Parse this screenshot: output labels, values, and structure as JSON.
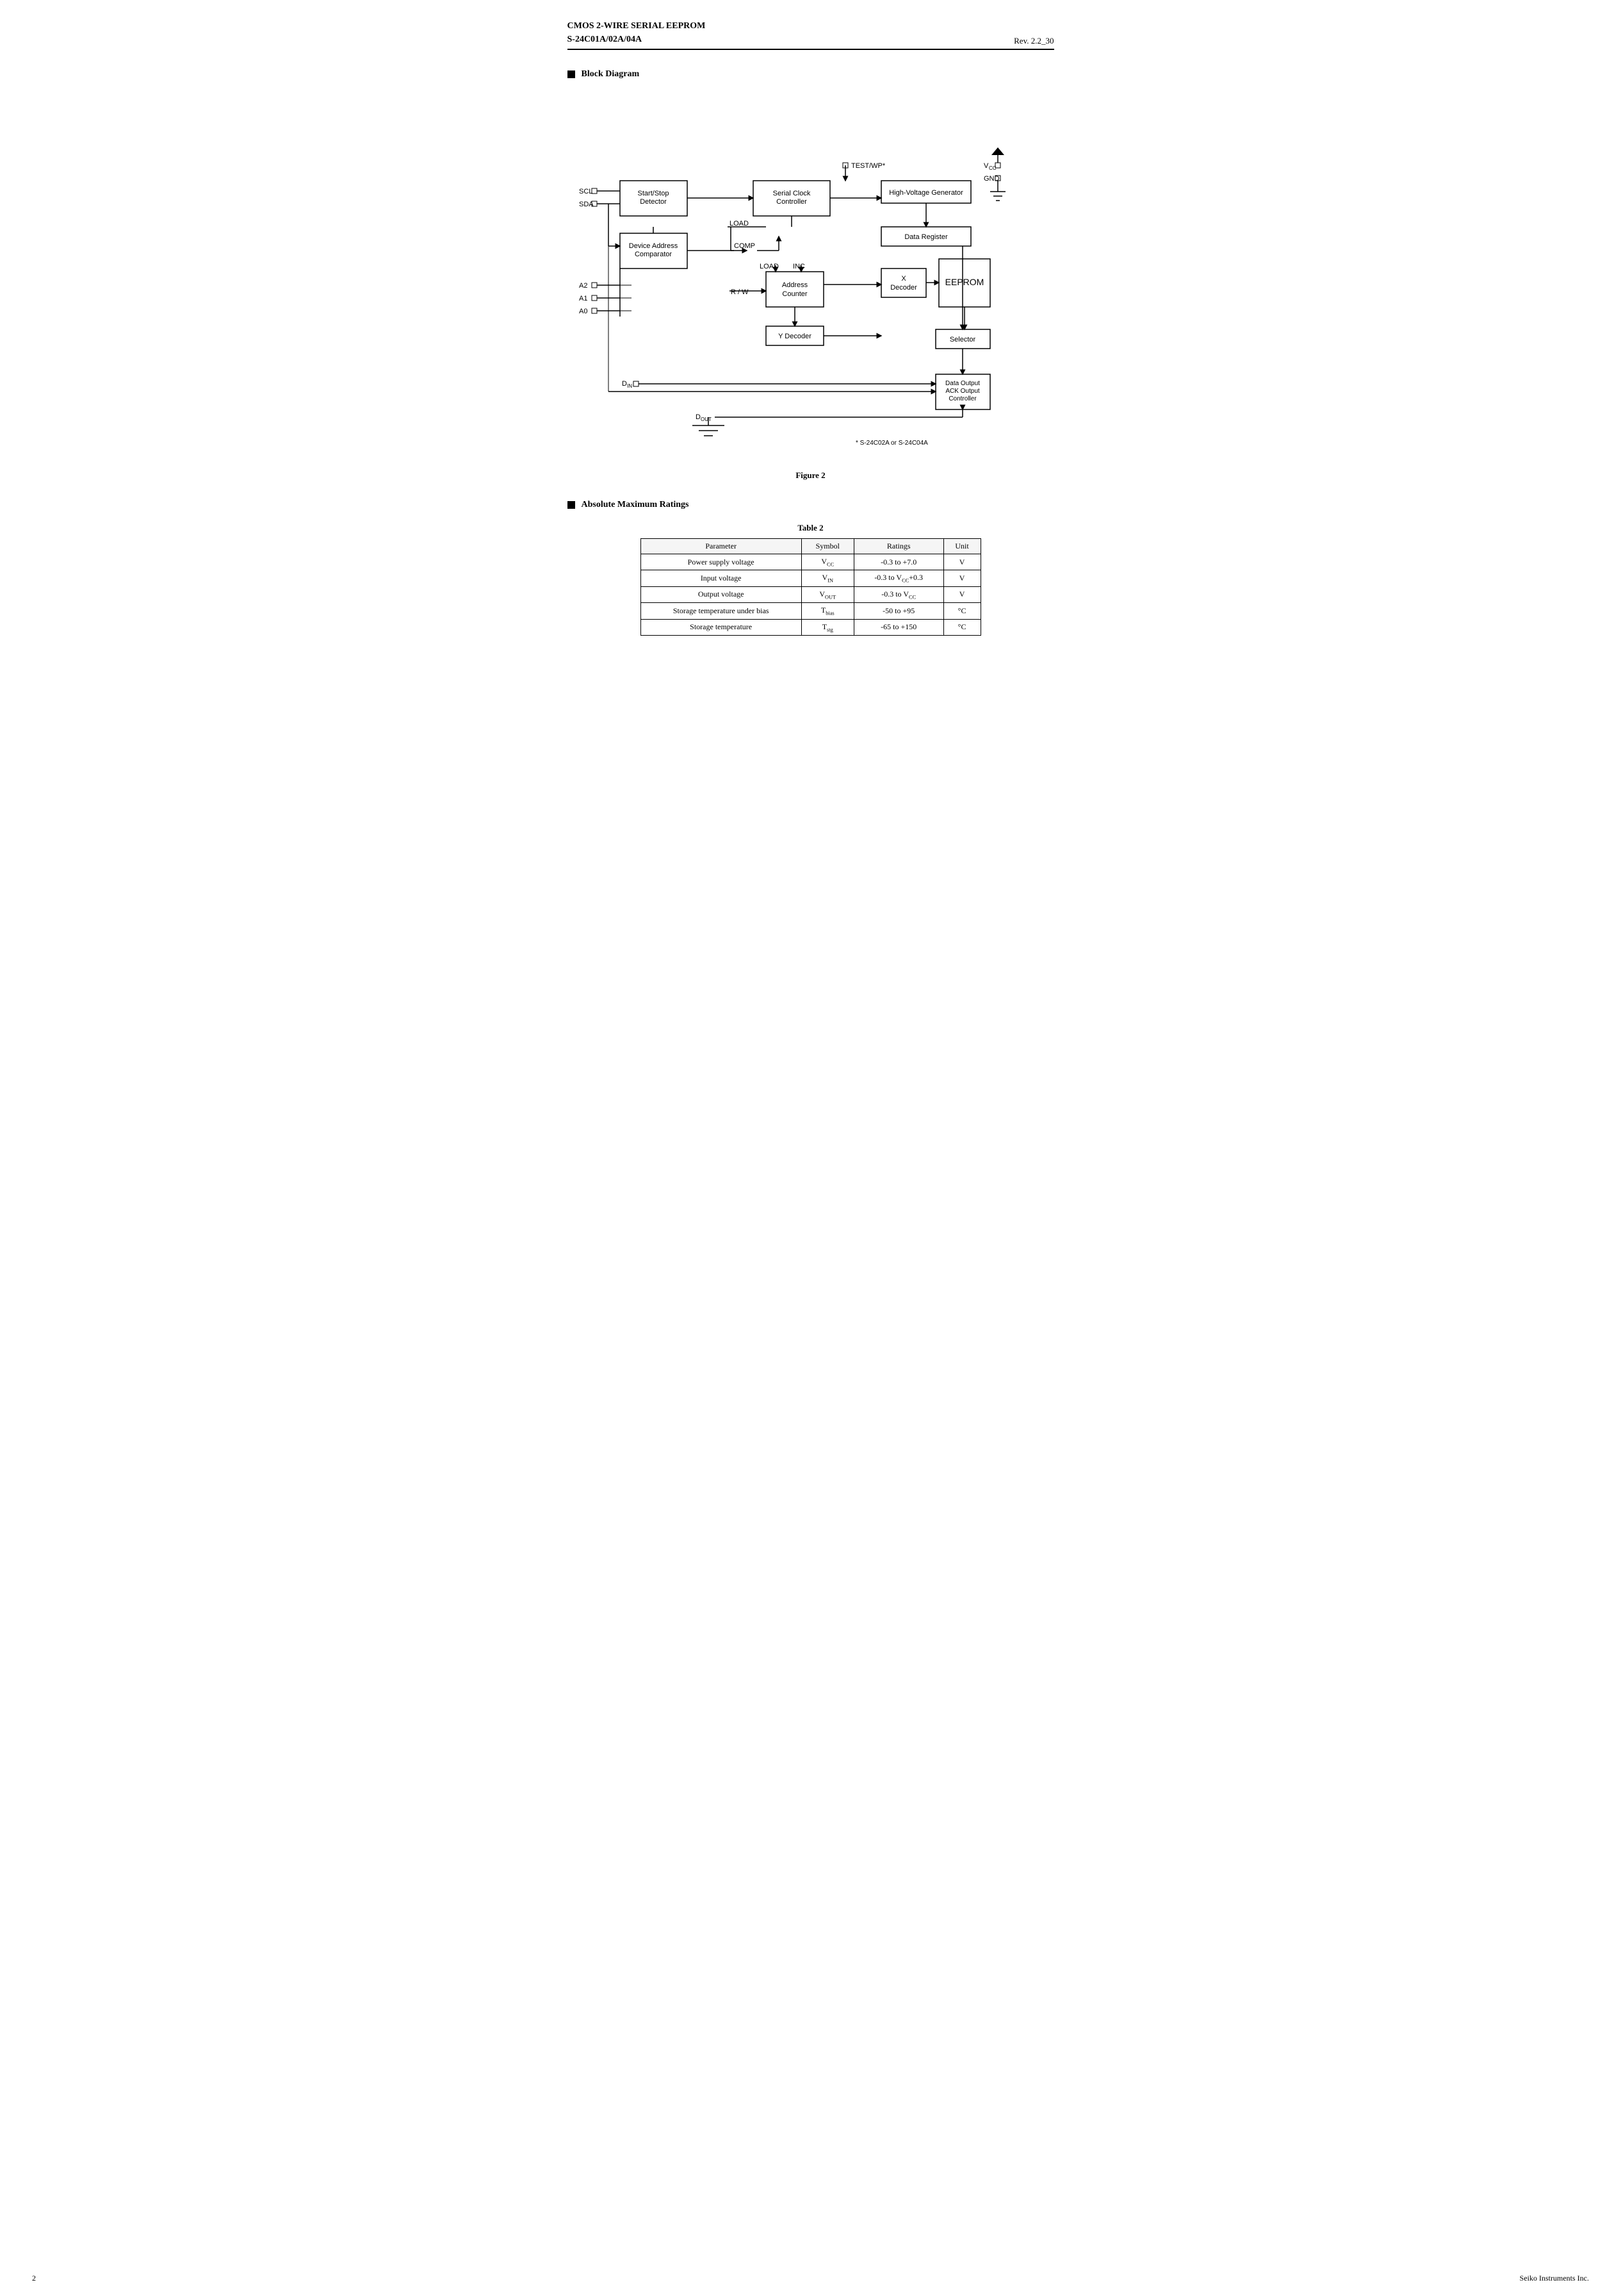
{
  "header": {
    "title_line1": "CMOS 2-WIRE SERIAL  EEPROM",
    "title_line2": "S-24C01A/02A/04A",
    "revision": "Rev. 2.2",
    "page_num": "30"
  },
  "block_diagram": {
    "section_label": "Block Diagram",
    "figure_label": "Figure 2",
    "footnote": "*  S-24C02A or S-24C04A",
    "blocks": [
      {
        "id": "start_stop",
        "label": "Start/Stop\nDetector"
      },
      {
        "id": "serial_clock",
        "label": "Serial Clock\nController"
      },
      {
        "id": "hv_gen",
        "label": "High-Voltage Generator"
      },
      {
        "id": "dev_addr",
        "label": "Device Address\nComparator"
      },
      {
        "id": "addr_counter",
        "label": "Address\nCounter"
      },
      {
        "id": "data_reg",
        "label": "Data Register"
      },
      {
        "id": "x_decoder",
        "label": "X\nDecoder"
      },
      {
        "id": "eeprom",
        "label": "EEPROM"
      },
      {
        "id": "y_decoder",
        "label": "Y Decoder"
      },
      {
        "id": "selector",
        "label": "Selector"
      },
      {
        "id": "data_out_ctrl",
        "label": "Data Output\nACK Output\nController"
      }
    ],
    "pins": [
      "SCL",
      "SDA",
      "A2",
      "A1",
      "A0",
      "D_IN",
      "D_OUT",
      "TEST_WP",
      "VCC",
      "GND"
    ]
  },
  "table": {
    "title": "Table  2",
    "headers": [
      "Parameter",
      "Symbol",
      "Ratings",
      "Unit"
    ],
    "rows": [
      [
        "Power supply voltage",
        "V_CC",
        "-0.3 to +7.0",
        "V"
      ],
      [
        "Input voltage",
        "V_IN",
        "-0.3 to V_CC+0.3",
        "V"
      ],
      [
        "Output voltage",
        "V_OUT",
        "-0.3 to V_CC",
        "V"
      ],
      [
        "Storage temperature under bias",
        "T_bias",
        "-50 to +95",
        "°C"
      ],
      [
        "Storage temperature",
        "T_stg",
        "-65 to +150",
        "°C"
      ]
    ]
  },
  "absolute_max": {
    "section_label": "Absolute Maximum Ratings"
  },
  "footer": {
    "page": "2",
    "company": "Seiko Instruments Inc."
  }
}
